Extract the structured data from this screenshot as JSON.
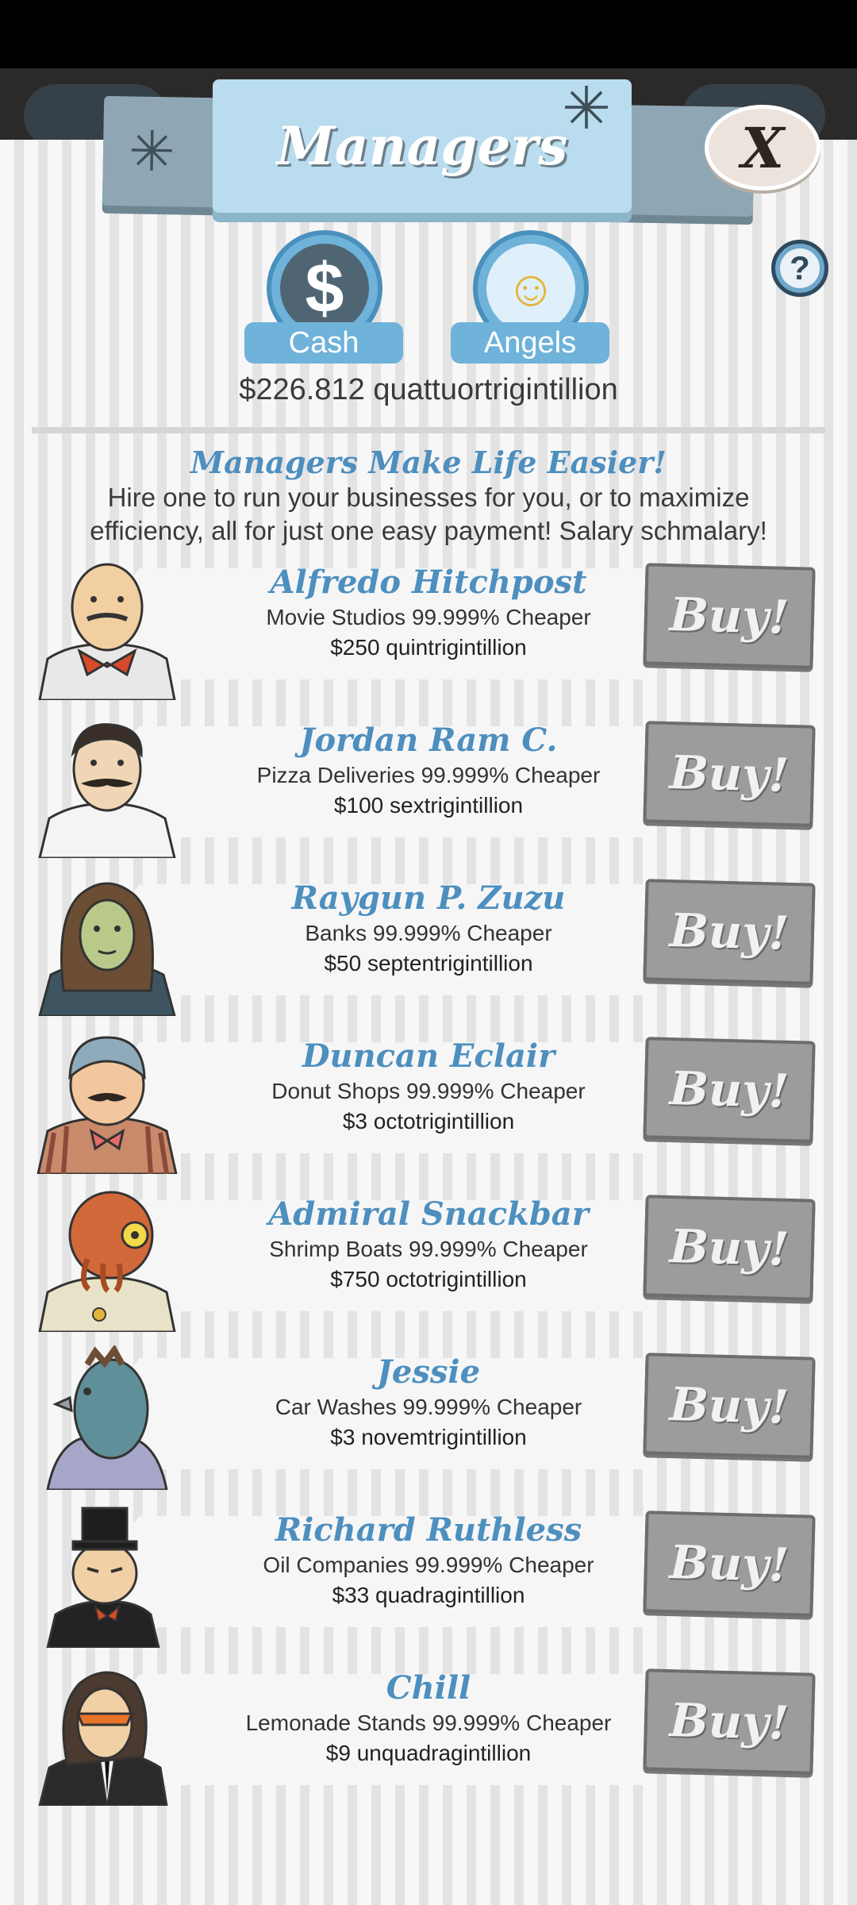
{
  "header": {
    "title": "Managers",
    "close_label": "X",
    "help_label": "?"
  },
  "currency": {
    "cash_label": "Cash",
    "angels_label": "Angels",
    "cash_amount": "$226.812 quattuortrigintillion"
  },
  "tagline": {
    "title": "Managers Make Life Easier!",
    "body": "Hire one to run your businesses for you, or to maximize efficiency, all for just one easy payment! Salary schmalary!"
  },
  "buy_label": "Buy!",
  "managers": [
    {
      "name": "Alfredo Hitchpost",
      "desc": "Movie Studios 99.999% Cheaper",
      "price": "$250 quintrigintillion"
    },
    {
      "name": "Jordan Ram C.",
      "desc": "Pizza Deliveries 99.999% Cheaper",
      "price": "$100 sextrigintillion"
    },
    {
      "name": "Raygun P. Zuzu",
      "desc": "Banks 99.999% Cheaper",
      "price": "$50 septentrigintillion"
    },
    {
      "name": "Duncan Eclair",
      "desc": "Donut Shops 99.999% Cheaper",
      "price": "$3 octotrigintillion"
    },
    {
      "name": "Admiral Snackbar",
      "desc": "Shrimp Boats 99.999% Cheaper",
      "price": "$750 octotrigintillion"
    },
    {
      "name": "Jessie",
      "desc": "Car Washes 99.999% Cheaper",
      "price": "$3 novemtrigintillion"
    },
    {
      "name": "Richard Ruthless",
      "desc": "Oil Companies 99.999% Cheaper",
      "price": "$33 quadragintillion"
    },
    {
      "name": "Chill",
      "desc": "Lemonade Stands 99.999% Cheaper",
      "price": "$9 unquadragintillion"
    }
  ],
  "icons": {
    "cash": "dollar-icon",
    "angels": "angel-icon",
    "help": "question-icon",
    "close": "close-icon"
  }
}
